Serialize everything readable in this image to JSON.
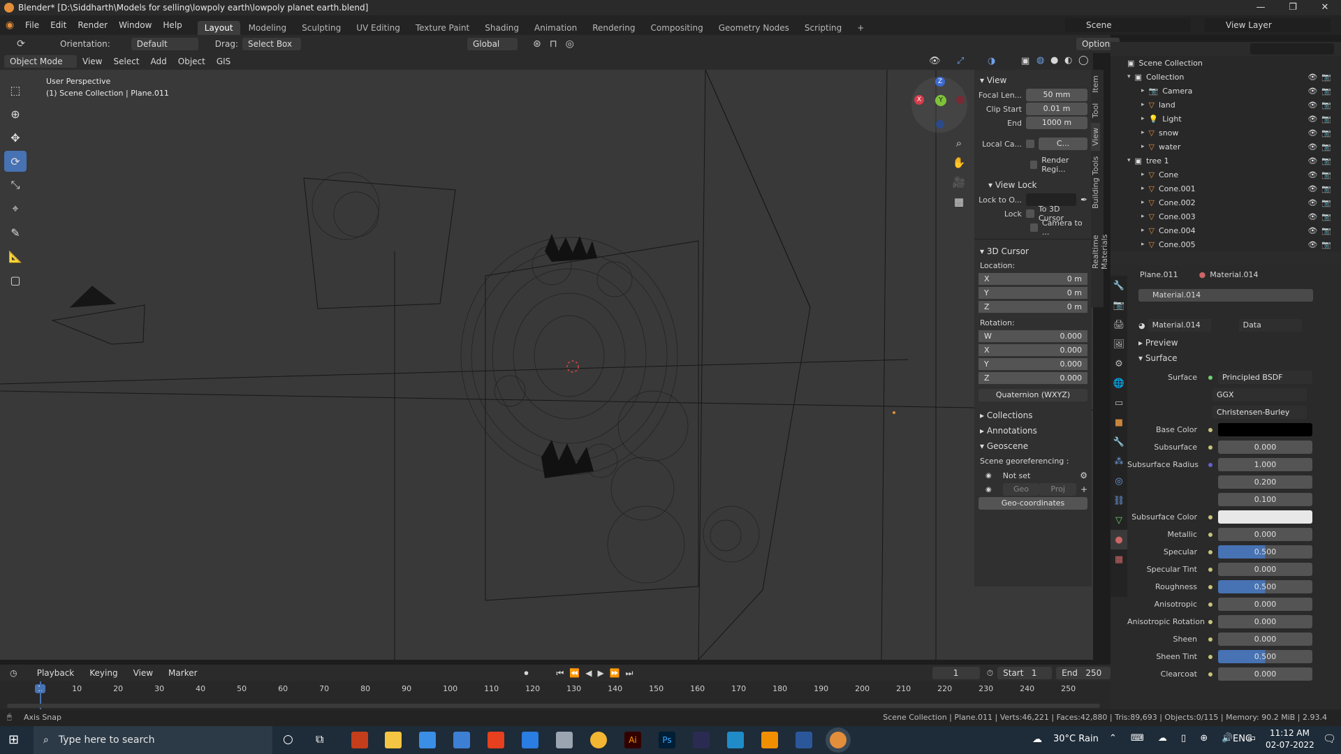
{
  "window": {
    "title": "Blender* [D:\\Siddharth\\Models for selling\\lowpoly earth\\lowpoly planet earth.blend]",
    "minimize": "—",
    "maximize": "❐",
    "close": "✕"
  },
  "menu": {
    "items": [
      "File",
      "Edit",
      "Render",
      "Window",
      "Help"
    ],
    "workspaces": [
      "Layout",
      "Modeling",
      "Sculpting",
      "UV Editing",
      "Texture Paint",
      "Shading",
      "Animation",
      "Rendering",
      "Compositing",
      "Geometry Nodes",
      "Scripting"
    ],
    "add_workspace": "+",
    "scene_label": "Scene",
    "view_layer_label": "View Layer"
  },
  "toolbar": {
    "orientation_label": "Orientation:",
    "orientation_value": "Default",
    "drag_label": "Drag:",
    "drag_value": "Select Box",
    "transform_orientation": "Global",
    "options": "Options"
  },
  "viewport_header": {
    "mode": "Object Mode",
    "menus": [
      "View",
      "Select",
      "Add",
      "Object",
      "GIS"
    ]
  },
  "viewport": {
    "perspective": "User Perspective",
    "collection_info": "(1) Scene Collection | Plane.011",
    "gizmo_x": "X",
    "gizmo_y": "Y",
    "gizmo_z": "Z"
  },
  "ntabs": [
    "Item",
    "Tool",
    "View",
    "Building Tools",
    "Realtime Materials"
  ],
  "npanel": {
    "view_header": "View",
    "focal_label": "Focal Len...",
    "focal_value": "50 mm",
    "clip_start_label": "Clip Start",
    "clip_start_value": "0.01 m",
    "end_label": "End",
    "end_value": "1000 m",
    "local_camera_label": "Local Ca...",
    "local_camera_value": "C...",
    "render_region_label": "Render Regi...",
    "view_lock_header": "View Lock",
    "lock_to_label": "Lock to O...",
    "lock_label": "Lock",
    "lock_3d_cursor": "To 3D Cursor",
    "lock_camera": "Camera to ...",
    "cursor_header": "3D Cursor",
    "location_label": "Location:",
    "loc_x_label": "X",
    "loc_x": "0 m",
    "loc_y_label": "Y",
    "loc_y": "0 m",
    "loc_z_label": "Z",
    "loc_z": "0 m",
    "rotation_label": "Rotation:",
    "rot_w_label": "W",
    "rot_w": "0.000",
    "rot_x_label": "X",
    "rot_x": "0.000",
    "rot_y_label": "Y",
    "rot_y": "0.000",
    "rot_z_label": "Z",
    "rot_z": "0.000",
    "rotation_mode": "Quaternion (WXYZ)",
    "collections_header": "Collections",
    "annotations_header": "Annotations",
    "geoscene_header": "Geoscene",
    "georef_label": "Scene georeferencing :",
    "not_set": "Not set",
    "geo_btn": "Geo",
    "proj_btn": "Proj",
    "geo_coords_btn": "Geo-coordinates"
  },
  "outliner": {
    "root": "Scene Collection",
    "rows": [
      {
        "name": "Collection",
        "level": 1,
        "type": "collection"
      },
      {
        "name": "Camera",
        "level": 2,
        "type": "camera"
      },
      {
        "name": "land",
        "level": 2,
        "type": "mesh"
      },
      {
        "name": "Light",
        "level": 2,
        "type": "light"
      },
      {
        "name": "snow",
        "level": 2,
        "type": "mesh"
      },
      {
        "name": "water",
        "level": 2,
        "type": "mesh"
      },
      {
        "name": "tree 1",
        "level": 1,
        "type": "collection"
      },
      {
        "name": "Cone",
        "level": 2,
        "type": "mesh"
      },
      {
        "name": "Cone.001",
        "level": 2,
        "type": "mesh"
      },
      {
        "name": "Cone.002",
        "level": 2,
        "type": "mesh"
      },
      {
        "name": "Cone.003",
        "level": 2,
        "type": "mesh"
      },
      {
        "name": "Cone.004",
        "level": 2,
        "type": "mesh"
      },
      {
        "name": "Cone.005",
        "level": 2,
        "type": "mesh"
      }
    ]
  },
  "properties": {
    "object_name": "Plane.011",
    "material_crumb": "Material.014",
    "slot": "Material.014",
    "material_name": "Material.014",
    "data_link": "Data",
    "preview": "Preview",
    "surface_header": "Surface",
    "surface_label": "Surface",
    "surface_shader": "Principled BSDF",
    "distribution": "GGX",
    "subsurface_method": "Christensen-Burley",
    "rows": [
      {
        "label": "Base Color",
        "value": "",
        "kind": "color-black"
      },
      {
        "label": "Subsurface",
        "value": "0.000",
        "kind": "num"
      },
      {
        "label": "Subsurface Radius",
        "value": "1.000",
        "kind": "num"
      },
      {
        "label": "",
        "value": "0.200",
        "kind": "num"
      },
      {
        "label": "",
        "value": "0.100",
        "kind": "num"
      },
      {
        "label": "Subsurface Color",
        "value": "",
        "kind": "color-white"
      },
      {
        "label": "Metallic",
        "value": "0.000",
        "kind": "num"
      },
      {
        "label": "Specular",
        "value": "0.500",
        "kind": "blue"
      },
      {
        "label": "Specular Tint",
        "value": "0.000",
        "kind": "num"
      },
      {
        "label": "Roughness",
        "value": "0.500",
        "kind": "blue"
      },
      {
        "label": "Anisotropic",
        "value": "0.000",
        "kind": "num"
      },
      {
        "label": "Anisotropic Rotation",
        "value": "0.000",
        "kind": "num"
      },
      {
        "label": "Sheen",
        "value": "0.000",
        "kind": "num"
      },
      {
        "label": "Sheen Tint",
        "value": "0.500",
        "kind": "blue"
      },
      {
        "label": "Clearcoat",
        "value": "0.000",
        "kind": "num"
      }
    ]
  },
  "timeline": {
    "menus": [
      "Playback",
      "Keying",
      "View",
      "Marker"
    ],
    "current_frame": "1",
    "start_label": "Start",
    "start": "1",
    "end_label": "End",
    "end": "250",
    "ticks": [
      "1",
      "10",
      "20",
      "30",
      "40",
      "50",
      "60",
      "70",
      "80",
      "90",
      "100",
      "110",
      "120",
      "130",
      "140",
      "150",
      "160",
      "170",
      "180",
      "190",
      "200",
      "210",
      "220",
      "230",
      "240",
      "250"
    ]
  },
  "status": {
    "left": "Axis Snap",
    "right": "Scene Collection | Plane.011 | Verts:46,221 | Faces:42,880 | Tris:89,693 | Objects:0/115 | Memory: 90.2 MiB | 2.93.4"
  },
  "taskbar": {
    "search_placeholder": "Type here to search",
    "weather": "30°C  Rain",
    "language": "ENG",
    "time": "11:12 AM",
    "date": "02-07-2022"
  },
  "colors": {
    "accent": "#4772b3",
    "orange": "#e38e3a",
    "green": "#6fcf6f",
    "viewport_bg": "#393939"
  }
}
